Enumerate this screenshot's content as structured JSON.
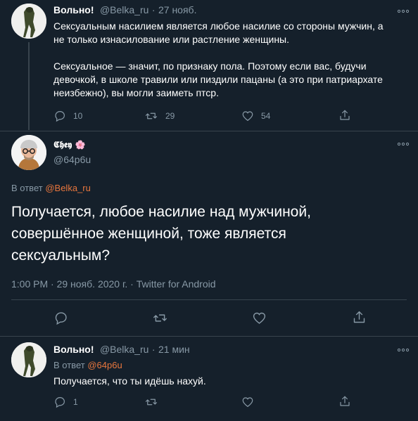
{
  "tweet1": {
    "name": "Вольно!",
    "handle": "@Belka_ru",
    "sep": "·",
    "time": "27 нояб.",
    "text_p1_l1": "Сексуальным насилием является любое насилие со стороны мужчин, а",
    "text_p1_l2": "не только изнасилование или растление женщины.",
    "text_p2_l1": "Сексуальное — значит, по признаку пола. Поэтому если вас, будучи",
    "text_p2_l2": "девочкой, в школе травили или пиздили пацаны (а это при патриархате",
    "text_p2_l3": "неизбежно), вы могли заиметь птср.",
    "replies": "10",
    "retweets": "29",
    "likes": "54"
  },
  "tweet2": {
    "name": "𝕮𝖍𝖊𝖞",
    "flower": "🌸",
    "handle": "@64p6u",
    "reply_prefix": "В ответ",
    "reply_to": "@Belka_ru",
    "text_l1": "Получается, любое насилие над мужчиной,",
    "text_l2": "совершённое женщиной, тоже является",
    "text_l3": "сексуальным?",
    "timestamp": "1:00 PM · 29 нояб. 2020 г. · Twitter for Android"
  },
  "tweet3": {
    "name": "Вольно!",
    "handle": "@Belka_ru",
    "sep": "·",
    "time": "21 мин",
    "reply_prefix": "В ответ",
    "reply_to": "@64p6u",
    "text": "Получается, что ты идёшь нахуй.",
    "replies": "1"
  },
  "colors": {
    "background": "#15202b",
    "text": "#ffffff",
    "muted": "#8899a6",
    "link": "#e8763d",
    "divider": "#38444d"
  },
  "icons": [
    "more-icon",
    "reply-icon",
    "retweet-icon",
    "like-icon",
    "share-icon"
  ]
}
